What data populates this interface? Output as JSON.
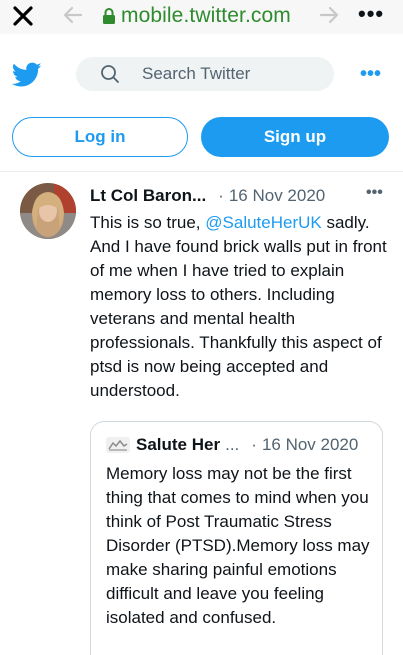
{
  "browser": {
    "url": "mobile.twitter.com",
    "more": "•••"
  },
  "header": {
    "search_placeholder": "Search Twitter",
    "more": "•••",
    "brand_color": "#1d9bf0"
  },
  "auth": {
    "login_label": "Log in",
    "signup_label": "Sign up"
  },
  "tweet": {
    "author": "Lt Col Baron...",
    "separator": "·",
    "date": "16 Nov 2020",
    "more": "•••",
    "text_before": "This is so true, ",
    "mention": "@SaluteHerUK",
    "text_after": " sadly. And I have found brick walls put in front of me when I have tried to explain memory loss to others. Including veterans and mental health professionals. Thankfully this aspect of ptsd is now being accepted and understood."
  },
  "quoted": {
    "author": "Salute Her",
    "ellipsis": "...",
    "separator": "·",
    "date": "16 Nov 2020",
    "text": "Memory loss may not be the first thing that comes to mind when you think of Post Traumatic Stress Disorder (PTSD).Memory loss may make sharing painful emotions difficult and leave you feeling isolated and confused."
  }
}
